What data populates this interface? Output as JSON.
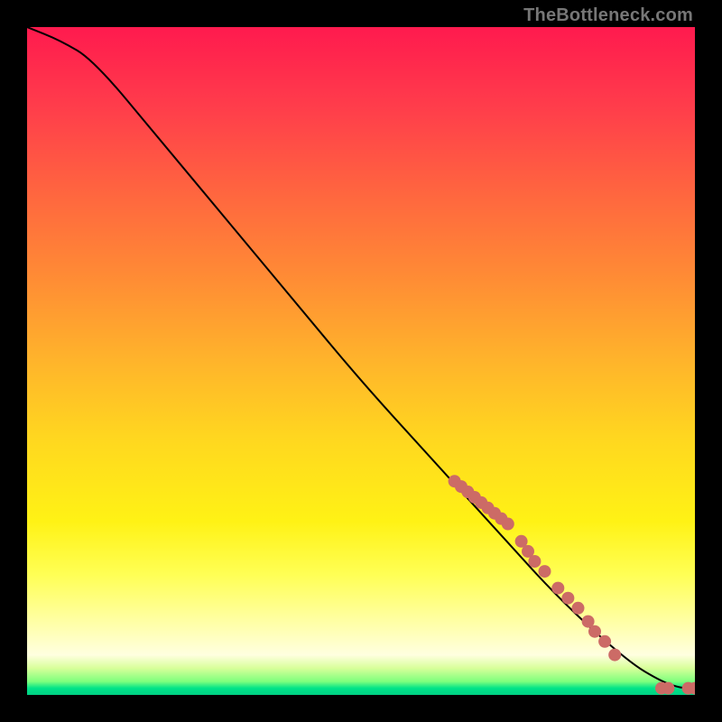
{
  "attribution": "TheBottleneck.com",
  "chart_data": {
    "type": "line",
    "title": "",
    "xlabel": "",
    "ylabel": "",
    "xlim": [
      0,
      100
    ],
    "ylim": [
      0,
      100
    ],
    "curve": {
      "name": "bottleneck-curve",
      "x": [
        0,
        5,
        10,
        20,
        30,
        40,
        50,
        60,
        70,
        80,
        90,
        95,
        98,
        100
      ],
      "y": [
        100,
        98,
        95,
        83,
        71,
        59,
        47,
        36,
        25,
        14,
        5,
        2,
        1,
        1
      ]
    },
    "dots": {
      "name": "sample-points",
      "color": "#cc6b66",
      "radius": 7,
      "points": [
        {
          "x": 64,
          "y": 32
        },
        {
          "x": 65,
          "y": 31.2
        },
        {
          "x": 66,
          "y": 30.4
        },
        {
          "x": 67,
          "y": 29.6
        },
        {
          "x": 68,
          "y": 28.8
        },
        {
          "x": 69,
          "y": 28
        },
        {
          "x": 70,
          "y": 27.2
        },
        {
          "x": 71,
          "y": 26.4
        },
        {
          "x": 72,
          "y": 25.6
        },
        {
          "x": 74,
          "y": 23
        },
        {
          "x": 75,
          "y": 21.5
        },
        {
          "x": 76,
          "y": 20
        },
        {
          "x": 77.5,
          "y": 18.5
        },
        {
          "x": 79.5,
          "y": 16
        },
        {
          "x": 81,
          "y": 14.5
        },
        {
          "x": 82.5,
          "y": 13
        },
        {
          "x": 84,
          "y": 11
        },
        {
          "x": 85,
          "y": 9.5
        },
        {
          "x": 86.5,
          "y": 8
        },
        {
          "x": 88,
          "y": 6
        },
        {
          "x": 95,
          "y": 1
        },
        {
          "x": 96,
          "y": 1
        },
        {
          "x": 99,
          "y": 1
        },
        {
          "x": 100,
          "y": 1
        }
      ]
    }
  }
}
